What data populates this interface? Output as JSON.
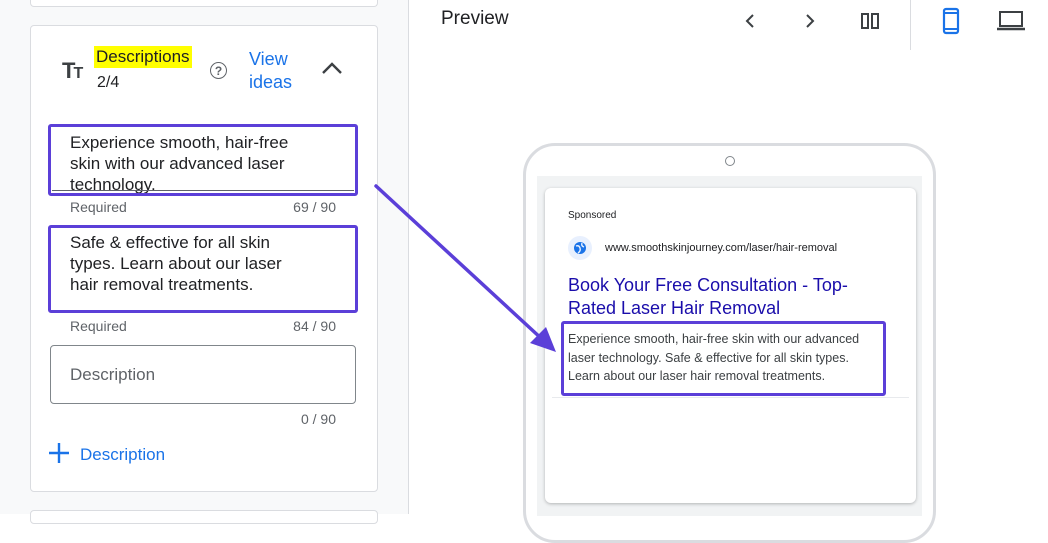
{
  "left_panel": {
    "section_icon": "text-size-icon",
    "section_title": "Descriptions",
    "count": "2/4",
    "help_icon": "help-circle-icon",
    "view_ideas_label": "View ideas",
    "collapse_icon": "chevron-up-icon",
    "descriptions": [
      {
        "value": "Experience smooth, hair-free skin with our advanced laser technology.",
        "helper": "Required",
        "counter": "69 / 90"
      },
      {
        "value": "Safe & effective for all skin types.  Learn about our laser hair removal treatments.",
        "helper": "Required",
        "counter": "84 / 90"
      },
      {
        "value": "",
        "placeholder": "Description",
        "helper": "",
        "counter": "0 / 90"
      }
    ],
    "add_description": {
      "icon": "plus-icon",
      "label": "Description"
    }
  },
  "preview": {
    "title": "Preview",
    "toolbar": [
      {
        "icon": "chevron-left-icon"
      },
      {
        "icon": "chevron-right-icon"
      },
      {
        "icon": "columns-icon"
      },
      {
        "icon": "smartphone-icon",
        "active": true
      },
      {
        "icon": "laptop-icon"
      }
    ],
    "ad": {
      "sponsored": "Sponsored",
      "favicon": "globe-icon",
      "url": "www.smoothskinjourney.com/laser/hair-removal",
      "headline": "Book Your Free Consultation - Top-Rated Laser Hair Removal",
      "description": "Experience smooth, hair-free skin with our advanced laser technology. Safe & effective for all skin types. Learn about our laser hair removal treatments."
    }
  },
  "colors": {
    "highlight": "#ffff00",
    "annotation": "#5b3fd8",
    "link": "#1a73e8",
    "headline": "#1a0dab"
  }
}
